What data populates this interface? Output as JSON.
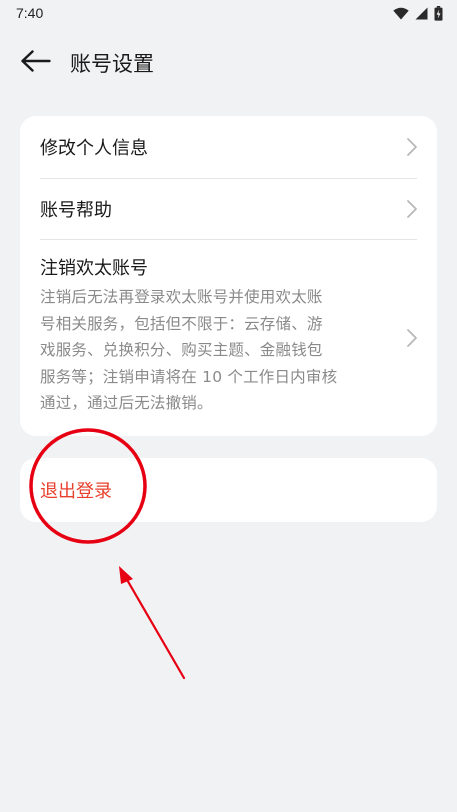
{
  "status_bar": {
    "time": "7:40",
    "icons": [
      "wifi-icon",
      "signal-icon",
      "battery-icon"
    ]
  },
  "header": {
    "back_icon": "arrow-left-icon",
    "title": "账号设置"
  },
  "settings": {
    "items": [
      {
        "label": "修改个人信息",
        "icon": "chevron-right-icon"
      },
      {
        "label": "账号帮助",
        "icon": "chevron-right-icon"
      },
      {
        "label": "注销欢太账号",
        "description_lines": [
          "注销后无法再登录欢太账号并使用欢太账",
          "号相关服务，包括但不限于：云存储、游",
          "戏服务、兑换积分、购买主题、金融钱包",
          "服务等；注销申请将在 10 个工作日内审核",
          "通过，通过后无法撤销。"
        ],
        "icon": "chevron-right-icon"
      }
    ]
  },
  "logout": {
    "label": "退出登录"
  },
  "colors": {
    "background": "#f1f2f4",
    "card": "#ffffff",
    "logout_text": "#e8402d",
    "annotation_red": "#e60012",
    "secondary_text": "#8a8a8a"
  },
  "annotations": {
    "circle_highlight": "red-circle-around-logout",
    "arrow": "red-arrow-pointing-to-logout"
  }
}
